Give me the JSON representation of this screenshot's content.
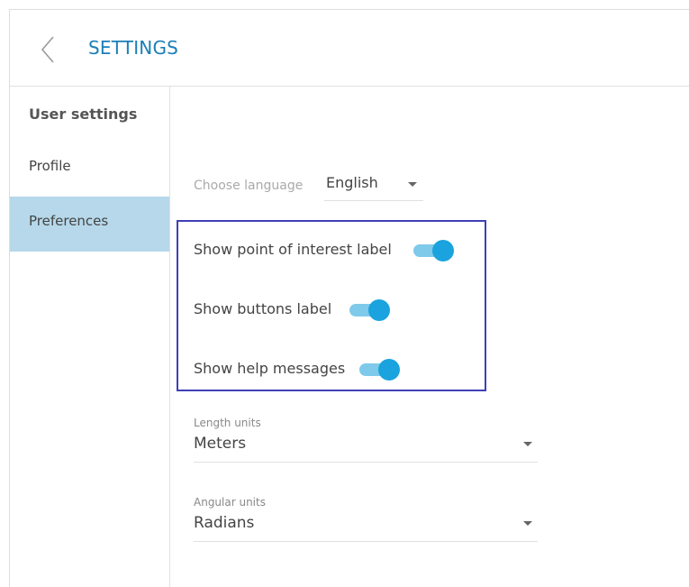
{
  "header": {
    "title": "SETTINGS",
    "back_icon": "chevron-left-icon"
  },
  "sidebar": {
    "heading": "User settings",
    "items": [
      {
        "label": "Profile",
        "active": false
      },
      {
        "label": "Preferences",
        "active": true
      }
    ]
  },
  "preferences": {
    "language": {
      "label": "Choose language",
      "value": "English"
    },
    "toggles": [
      {
        "label": "Show point of interest label",
        "on": true
      },
      {
        "label": "Show buttons label",
        "on": true
      },
      {
        "label": "Show help messages",
        "on": true
      }
    ],
    "length_units": {
      "label": "Length units",
      "value": "Meters"
    },
    "angular_units": {
      "label": "Angular units",
      "value": "Radians"
    }
  },
  "colors": {
    "accent": "#1a7fb8",
    "active_sidebar_bg": "#b6d8ea",
    "toggle_thumb": "#1aa3de",
    "toggle_track": "#7fcaea",
    "highlight_border": "#3e40b8"
  }
}
